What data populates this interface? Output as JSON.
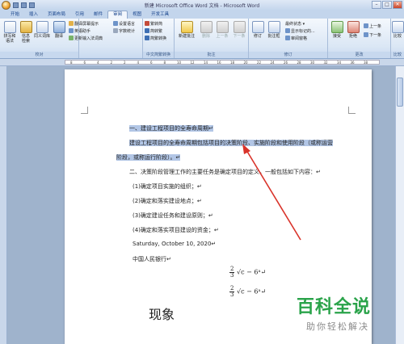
{
  "window": {
    "title": "新建 Microsoft Office Word 文档 - Microsoft Word",
    "minimize": "–",
    "restore": "□",
    "close": "✕"
  },
  "tabs": [
    "开始",
    "插入",
    "页面布局",
    "引用",
    "邮件",
    "审阅",
    "视图",
    "开发工具"
  ],
  "active_tab": "审阅",
  "ribbon": {
    "proofing": {
      "label": "校对",
      "spelling": "拼写和\n语法",
      "research": "信息\n检索",
      "thesaurus": "同义词库",
      "translate": "翻译",
      "translate_tip": "翻译屏幕提示",
      "language": "英语助手",
      "update_ime": "更新输入法词典",
      "set_language": "设置语言",
      "word_count": "字数统计"
    },
    "chinese": {
      "label": "中文简繁转换",
      "to_trad": "繁转简",
      "to_simp": "简转繁",
      "convert": "简繁转换"
    },
    "comments": {
      "label": "批注",
      "new": "新建批注",
      "delete": "删除",
      "prev": "上一条",
      "next": "下一条"
    },
    "tracking": {
      "label": "修订",
      "track": "修订",
      "balloons": "批注框",
      "markup": "最终状态",
      "show_markup": "显示标记",
      "show_markup_option": "显示标记的...",
      "reviewing_pane": "审阅窗格"
    },
    "changes": {
      "label": "更改",
      "accept": "接受",
      "reject": "拒绝",
      "prev": "上一条",
      "next": "下一条"
    },
    "compare": {
      "label": "比较",
      "compare": "比较"
    }
  },
  "ruler_marks": [
    "8",
    "6",
    "4",
    "2",
    "2",
    "4",
    "6",
    "8",
    "10",
    "12",
    "14",
    "16",
    "18",
    "20",
    "22",
    "24",
    "26",
    "28",
    "30",
    "32",
    "34",
    "36",
    "38"
  ],
  "document": {
    "heading1": "一、建设工程项目的全寿命周期↵",
    "para1_line1": "建设工程项目的全寿命周期包括项目的决策阶段、实施阶段和使用阶段（或称运营",
    "para1_line2": "阶段，或称运行阶段）。↵",
    "heading2": "二、决策阶段管理工作的主要任务是确定项目的定义，一般包括如下内容：↵",
    "items": [
      "(1)确定项目实施的组织；↵",
      "(2)确定和落实建设地点；↵",
      "(3)确定建设任务和建设原则；↵",
      "(4)确定和落实项目建设的资金；↵"
    ],
    "date": "Saturday, October 10, 2020↵",
    "bank": "中国人民银行↵",
    "formula1": {
      "num": "2",
      "den": "3",
      "rest": "√c − 6ᵃ↵"
    },
    "formula2": {
      "num": "2",
      "den": "3",
      "rest": "√c − 6ᵃ↵"
    },
    "phenomenon": "现象"
  },
  "watermark": {
    "logo": "百科全说",
    "sub": "助你轻松解决"
  },
  "colors": {
    "selection": "#b2c6e6",
    "arrow": "#d9332a",
    "watermark": "#2aa34a"
  }
}
